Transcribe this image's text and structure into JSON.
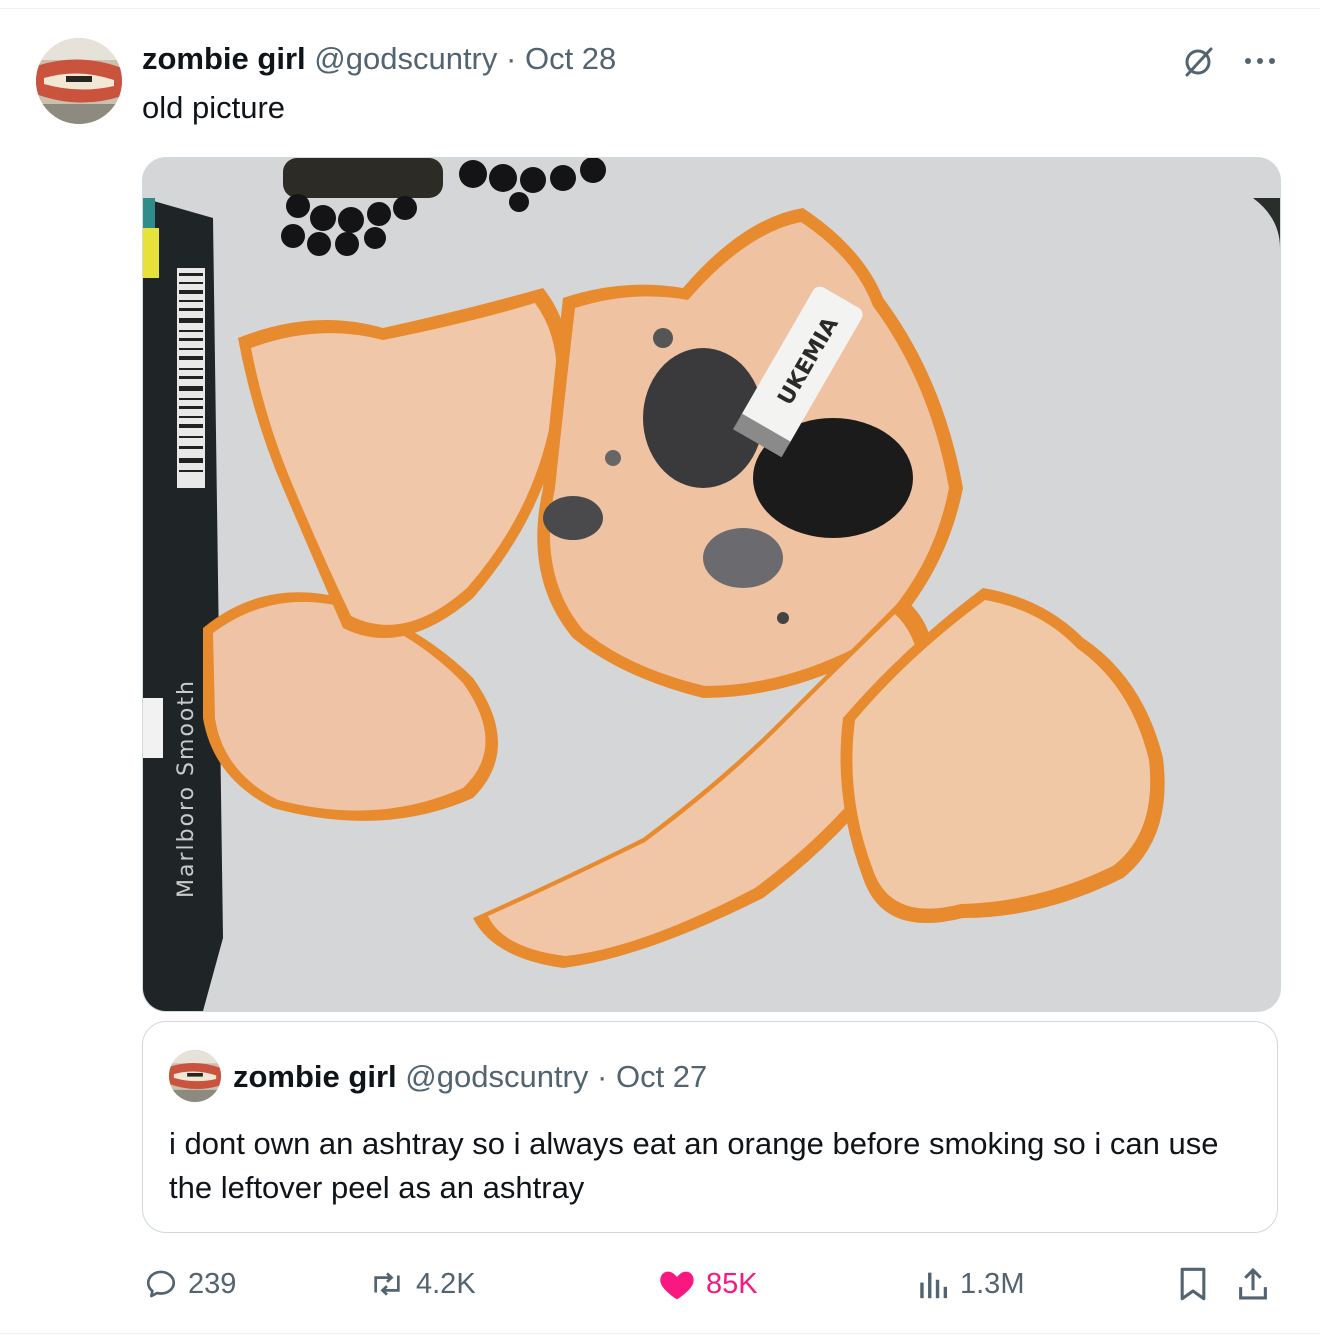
{
  "tweet": {
    "author_name": "zombie girl",
    "handle": "@godscuntry",
    "separator": "·",
    "date": "Oct 28",
    "text": "old picture",
    "photo": {
      "pack_text": "Marlboro Smooth",
      "filter_text": "UKEMIA"
    }
  },
  "quote": {
    "author_name": "zombie girl",
    "handle": "@godscuntry",
    "separator": "·",
    "date": "Oct 27",
    "text": "i dont own an ashtray so i always eat an orange before smoking so i can use the leftover peel as an ashtray"
  },
  "actions": {
    "replies": "239",
    "reposts": "4.2K",
    "likes": "85K",
    "views": "1.3M"
  },
  "colors": {
    "like": "#f91880",
    "muted": "#536471",
    "text": "#0f1419",
    "border": "#cfd9de"
  },
  "icons": [
    "grok-icon",
    "more-icon",
    "reply-icon",
    "repost-icon",
    "heart-icon",
    "views-icon",
    "bookmark-icon",
    "share-icon"
  ]
}
